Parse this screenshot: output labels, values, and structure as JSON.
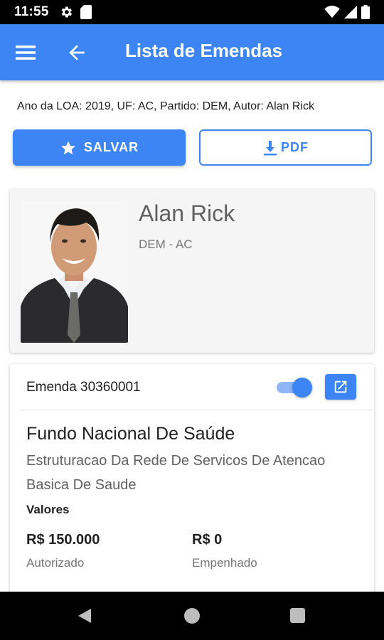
{
  "status_bar": {
    "time": "11:55",
    "icons": [
      "gear-icon",
      "sd-card-icon",
      "wifi-icon",
      "signal-icon",
      "battery-icon"
    ]
  },
  "app_bar": {
    "title": "Lista de Emendas",
    "icons": [
      "menu-icon",
      "arrow-back-icon"
    ],
    "color": "#3d85f5"
  },
  "filter": {
    "text": "Ano da LOA: 2019, UF: AC, Partido: DEM, Autor: Alan Rick"
  },
  "actions": {
    "save_label": "SALVAR",
    "save_icon": "star-icon",
    "pdf_label": "PDF",
    "pdf_icon": "download-icon"
  },
  "profile": {
    "name": "Alan Rick",
    "party": "DEM - AC",
    "photo": "politician-portrait"
  },
  "emenda": {
    "header": "Emenda 30360001",
    "toggle_on": true,
    "open_icon": "open-in-new-icon",
    "title": "Fundo Nacional De Saúde",
    "subtitle": "Estruturacao Da Rede De Servicos De Atencao Basica De Saude",
    "valores_label": "Valores",
    "values": [
      {
        "amount": "R$ 150.000",
        "caption": "Autorizado"
      },
      {
        "amount": "R$ 0",
        "caption": "Empenhado"
      }
    ]
  },
  "nav_bar": {
    "icons": [
      "nav-back-icon",
      "nav-home-icon",
      "nav-recents-icon"
    ]
  },
  "colors": {
    "primary": "#3d85f5",
    "toggle_track": "#8fb6f6",
    "card_bg": "#f5f5f5"
  }
}
